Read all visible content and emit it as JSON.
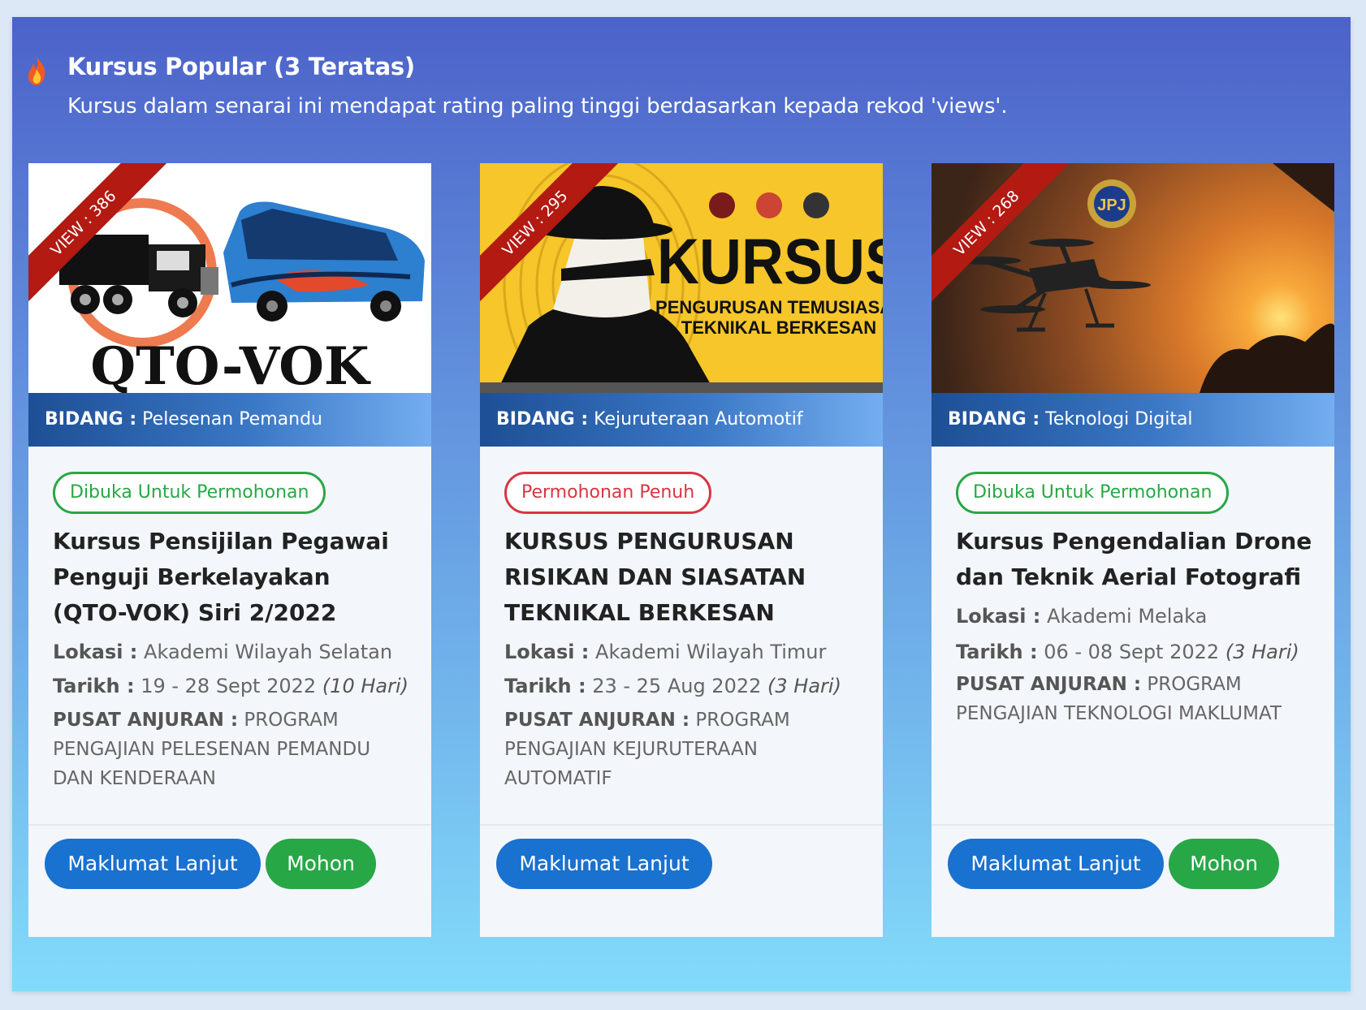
{
  "section": {
    "title": "Kursus Popular (3 Teratas)",
    "subtitle": "Kursus dalam senarai ini mendapat rating paling tinggi berdasarkan kepada rekod 'views'.",
    "icon": "fire-icon"
  },
  "cards": [
    {
      "views": "VIEW : 386",
      "image_text": "QTO-VOK",
      "bidang_label": "BIDANG :",
      "bidang": "Pelesenan Pemandu",
      "status": "Dibuka Untuk Permohonan",
      "title": "Kursus Pensijilan Pegawai Penguji Berkelayakan (QTO-VOK) Siri 2/2022",
      "lokasi_label": "Lokasi :",
      "lokasi": "Akademi Wilayah Selatan",
      "tarikh_label": "Tarikh :",
      "tarikh": "19 - 28 Sept 2022",
      "durasi": "(10 Hari)",
      "pusat_label": "PUSAT ANJURAN :",
      "pusat": "PROGRAM PENGAJIAN PELESENAN PEMANDU DAN KENDERAAN",
      "btn_info": "Maklumat Lanjut",
      "btn_apply": "Mohon"
    },
    {
      "views": "VIEW : 295",
      "image_text": "KURSUS",
      "image_sub": "PENGURUSAN TEMUSIASAT",
      "image_sub2": "TEKNIKAL BERKESAN",
      "bidang_label": "BIDANG :",
      "bidang": "Kejuruteraan Automotif",
      "status": "Permohonan Penuh",
      "title": "KURSUS PENGURUSAN RISIKAN DAN SIASATAN TEKNIKAL BERKESAN",
      "lokasi_label": "Lokasi :",
      "lokasi": "Akademi Wilayah Timur",
      "tarikh_label": "Tarikh :",
      "tarikh": "23 - 25 Aug 2022",
      "durasi": "(3 Hari)",
      "pusat_label": "PUSAT ANJURAN :",
      "pusat": "PROGRAM PENGAJIAN KEJURUTERAAN AUTOMATIF",
      "btn_info": "Maklumat Lanjut"
    },
    {
      "views": "VIEW : 268",
      "bidang_label": "BIDANG :",
      "bidang": "Teknologi Digital",
      "status": "Dibuka Untuk Permohonan",
      "title": "Kursus Pengendalian Drone dan Teknik Aerial Fotografi",
      "lokasi_label": "Lokasi :",
      "lokasi": "Akademi Melaka",
      "tarikh_label": "Tarikh :",
      "tarikh": "06 - 08 Sept 2022",
      "durasi": "(3 Hari)",
      "pusat_label": "PUSAT ANJURAN :",
      "pusat": "PROGRAM PENGAJIAN TEKNOLOGI MAKLUMAT",
      "btn_info": "Maklumat Lanjut",
      "btn_apply": "Mohon"
    }
  ]
}
